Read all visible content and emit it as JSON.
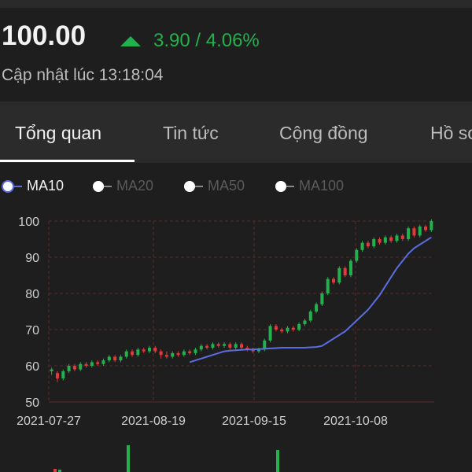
{
  "header": {
    "price": "100.00",
    "change": "3.90 / 4.06%",
    "updated": "Cập nhật lúc 13:18:04"
  },
  "tabs": [
    {
      "label": "Tổng quan",
      "active": true
    },
    {
      "label": "Tin tức",
      "active": false
    },
    {
      "label": "Cộng đồng",
      "active": false
    },
    {
      "label": "Hồ sơ",
      "active": false
    }
  ],
  "legend": [
    {
      "label": "MA10",
      "active": true
    },
    {
      "label": "MA20",
      "active": false
    },
    {
      "label": "MA50",
      "active": false
    },
    {
      "label": "MA100",
      "active": false
    }
  ],
  "colors": {
    "up": "#22b14c",
    "down": "#e03a3a",
    "ma10": "#5a6ee0",
    "grid": "#5a2a2a"
  },
  "chart_data": {
    "type": "candlestick",
    "ylim": [
      50,
      100
    ],
    "yticks": [
      50,
      60,
      70,
      80,
      90,
      100
    ],
    "xticks": [
      "2021-07-27",
      "2021-08-19",
      "2021-09-15",
      "2021-10-08"
    ],
    "grid": true,
    "candles": [
      [
        58.5,
        59.0,
        57.5,
        59.5
      ],
      [
        58.0,
        56.5,
        55.5,
        58.5
      ],
      [
        56.5,
        58.5,
        56.0,
        59.0
      ],
      [
        58.5,
        60.0,
        58.0,
        60.5
      ],
      [
        60.0,
        59.0,
        58.5,
        60.5
      ],
      [
        59.0,
        60.5,
        58.5,
        61.0
      ],
      [
        60.5,
        60.0,
        59.5,
        61.0
      ],
      [
        60.0,
        61.0,
        59.5,
        61.5
      ],
      [
        61.0,
        60.5,
        60.0,
        61.5
      ],
      [
        60.5,
        61.5,
        60.0,
        62.0
      ],
      [
        61.5,
        62.5,
        61.0,
        63.0
      ],
      [
        62.5,
        61.5,
        61.0,
        63.0
      ],
      [
        61.5,
        62.5,
        61.0,
        63.0
      ],
      [
        62.5,
        64.0,
        62.0,
        64.5
      ],
      [
        64.0,
        63.0,
        62.5,
        64.5
      ],
      [
        63.0,
        64.5,
        62.5,
        65.0
      ],
      [
        64.5,
        64.0,
        63.5,
        65.0
      ],
      [
        64.0,
        65.0,
        63.5,
        65.5
      ],
      [
        65.0,
        64.0,
        63.5,
        65.5
      ],
      [
        64.0,
        63.0,
        62.0,
        64.5
      ],
      [
        63.0,
        62.5,
        62.0,
        64.0
      ],
      [
        62.5,
        63.5,
        62.0,
        64.0
      ],
      [
        63.5,
        63.0,
        62.5,
        64.0
      ],
      [
        63.0,
        64.0,
        62.5,
        64.5
      ],
      [
        64.0,
        63.5,
        63.0,
        64.5
      ],
      [
        63.5,
        64.5,
        63.0,
        65.0
      ],
      [
        64.5,
        65.5,
        64.0,
        66.0
      ],
      [
        65.5,
        65.0,
        64.5,
        66.0
      ],
      [
        65.0,
        66.0,
        64.5,
        66.5
      ],
      [
        66.0,
        65.5,
        65.0,
        66.5
      ],
      [
        65.5,
        66.0,
        65.0,
        66.5
      ],
      [
        66.0,
        65.0,
        64.5,
        66.5
      ],
      [
        65.0,
        66.0,
        64.5,
        66.5
      ],
      [
        66.0,
        65.0,
        64.5,
        66.5
      ],
      [
        65.0,
        64.5,
        64.0,
        65.5
      ],
      [
        64.5,
        64.0,
        63.5,
        65.0
      ],
      [
        64.0,
        64.5,
        63.5,
        65.0
      ],
      [
        64.5,
        67.0,
        64.0,
        67.5
      ],
      [
        67.0,
        71.0,
        66.5,
        71.5
      ],
      [
        71.0,
        70.0,
        69.5,
        71.5
      ],
      [
        70.0,
        69.5,
        69.0,
        70.5
      ],
      [
        69.5,
        70.5,
        69.0,
        71.0
      ],
      [
        70.5,
        70.0,
        69.5,
        71.0
      ],
      [
        70.0,
        71.5,
        69.5,
        72.0
      ],
      [
        71.5,
        72.5,
        71.0,
        73.0
      ],
      [
        72.5,
        75.0,
        72.0,
        75.5
      ],
      [
        75.0,
        77.0,
        74.5,
        77.5
      ],
      [
        77.0,
        80.0,
        76.5,
        80.5
      ],
      [
        80.0,
        84.0,
        79.5,
        84.5
      ],
      [
        84.0,
        83.0,
        82.5,
        84.5
      ],
      [
        83.0,
        87.0,
        82.5,
        87.5
      ],
      [
        87.0,
        85.0,
        84.5,
        87.5
      ],
      [
        85.0,
        89.0,
        84.5,
        89.5
      ],
      [
        89.0,
        92.0,
        88.5,
        92.5
      ],
      [
        92.0,
        94.0,
        91.5,
        94.5
      ],
      [
        94.0,
        93.0,
        92.5,
        94.5
      ],
      [
        93.0,
        95.0,
        92.5,
        95.5
      ],
      [
        95.0,
        94.0,
        93.5,
        95.5
      ],
      [
        94.0,
        95.5,
        93.5,
        96.0
      ],
      [
        95.5,
        94.5,
        94.0,
        96.0
      ],
      [
        94.5,
        96.0,
        94.0,
        96.5
      ],
      [
        96.0,
        95.0,
        94.5,
        96.5
      ],
      [
        95.0,
        98.0,
        94.5,
        98.5
      ],
      [
        98.0,
        96.0,
        95.5,
        98.5
      ],
      [
        96.0,
        98.5,
        95.5,
        99.0
      ],
      [
        98.5,
        97.5,
        97.0,
        99.0
      ],
      [
        97.5,
        100.0,
        97.0,
        100.5
      ]
    ],
    "ma10": [
      61.0,
      61.5,
      62.0,
      62.5,
      63.0,
      63.5,
      64.0,
      64.2,
      64.3,
      64.4,
      64.5,
      64.5,
      64.6,
      64.7,
      64.8,
      64.9,
      65.0,
      65.0,
      65.0,
      65.0,
      65.0,
      65.1,
      65.2,
      65.5,
      66.5,
      67.5,
      68.5,
      69.5,
      71.0,
      72.5,
      74.0,
      75.5,
      77.5,
      79.5,
      82.0,
      84.5,
      87.0,
      89.0,
      91.0,
      92.5,
      93.5,
      94.5,
      95.5
    ]
  }
}
